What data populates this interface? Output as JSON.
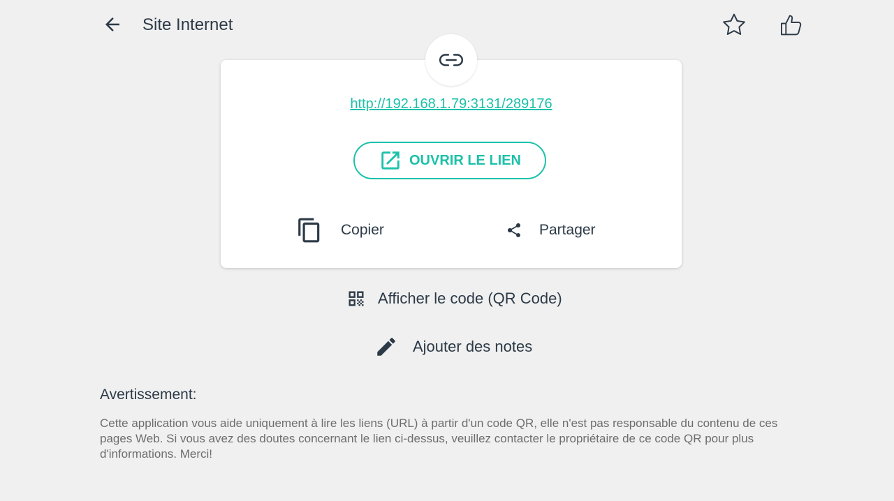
{
  "header": {
    "title": "Site Internet",
    "back_icon": "arrow-left-icon",
    "favorite_icon": "star-outline-icon",
    "like_icon": "thumbs-up-outline-icon"
  },
  "card": {
    "badge_icon": "link-icon",
    "url": "http://192.168.1.79:3131/289176",
    "open_button": {
      "label": "OUVRIR LE LIEN",
      "icon": "open-external-icon"
    },
    "copy": {
      "label": "Copier",
      "icon": "copy-icon"
    },
    "share": {
      "label": "Partager",
      "icon": "share-icon"
    }
  },
  "actions": {
    "qr": {
      "label": "Afficher le code (QR Code)",
      "icon": "qr-code-icon"
    },
    "notes": {
      "label": "Ajouter des notes",
      "icon": "pencil-icon"
    }
  },
  "warning": {
    "title": "Avertissement:",
    "text": "Cette application vous aide uniquement à lire les liens (URL) à partir d'un code QR, elle n'est pas responsable du contenu de ces pages Web. Si vous avez des doutes concernant le lien ci-dessus, veuillez contacter le propriétaire de ce code QR pour plus d'informations. Merci!"
  },
  "colors": {
    "accent": "#1cc1a9",
    "text_primary": "#2c3a47",
    "text_secondary": "#6d6d6d",
    "background": "#f0f0f0",
    "card": "#ffffff"
  }
}
